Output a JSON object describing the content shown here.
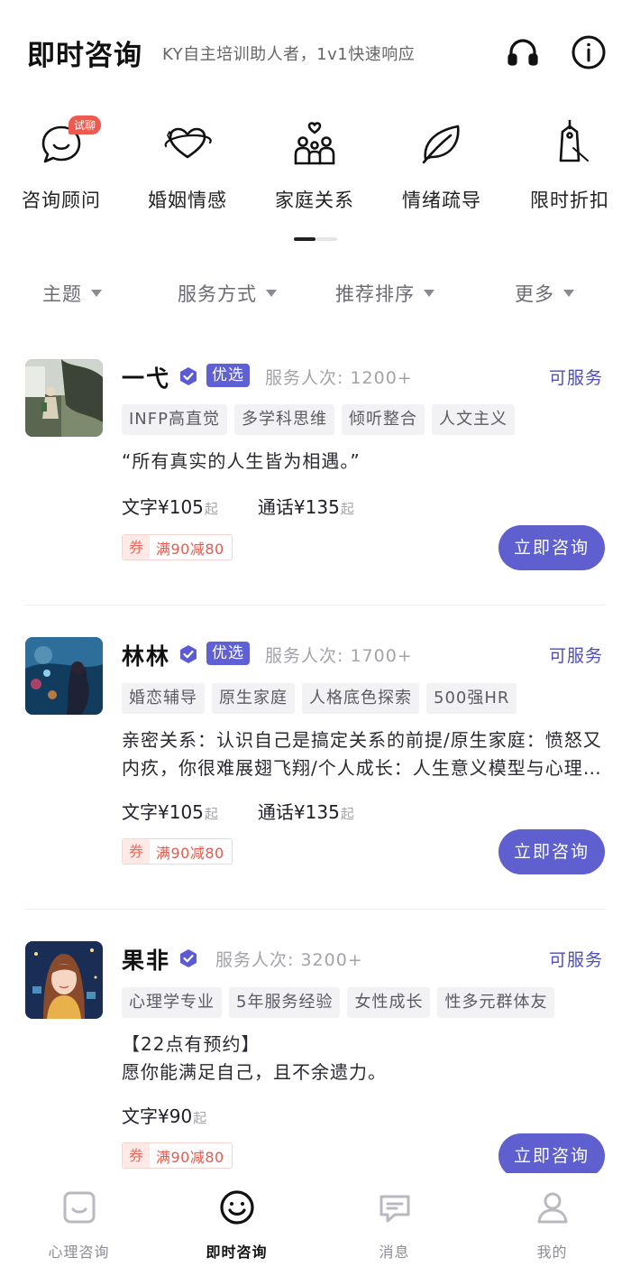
{
  "header": {
    "title": "即时咨询",
    "subtitle": "KY自主培训助人者，1v1快速响应",
    "headset_icon": "headset-icon",
    "info_icon": "info-icon"
  },
  "categories": [
    {
      "label": "咨询顾问",
      "icon": "chat-bubble-icon",
      "badge": "试聊"
    },
    {
      "label": "婚姻情感",
      "icon": "heart-ring-icon"
    },
    {
      "label": "家庭关系",
      "icon": "family-icon"
    },
    {
      "label": "情绪疏导",
      "icon": "leaf-icon"
    },
    {
      "label": "限时折扣",
      "icon": "price-tag-icon"
    }
  ],
  "filters": [
    "主题",
    "服务方式",
    "推荐排序",
    "更多"
  ],
  "counselors": [
    {
      "name": "一弋",
      "verified": true,
      "badge": "优选",
      "served": "服务人次: 1200+",
      "status": "可服务",
      "tags": [
        "INFP高直觉",
        "多学科思维",
        "倾听整合",
        "人文主义"
      ],
      "description": "“所有真实的人生皆为相遇。”",
      "prices": [
        {
          "type": "文字",
          "price": "¥105",
          "suffix": "起"
        },
        {
          "type": "通话",
          "price": "¥135",
          "suffix": "起"
        }
      ],
      "coupon_mark": "券",
      "coupon_text": "满90减80",
      "button": "立即咨询"
    },
    {
      "name": "林林",
      "verified": true,
      "badge": "优选",
      "served": "服务人次: 1700+",
      "status": "可服务",
      "tags": [
        "婚恋辅导",
        "原生家庭",
        "人格底色探索",
        "500强HR"
      ],
      "description": "亲密关系：认识自己是搞定关系的前提/原生家庭：愤怒又内疚，你很难展翅飞翔/个人成长：人生意义模型与心理学的结合",
      "prices": [
        {
          "type": "文字",
          "price": "¥105",
          "suffix": "起"
        },
        {
          "type": "通话",
          "price": "¥135",
          "suffix": "起"
        }
      ],
      "coupon_mark": "券",
      "coupon_text": "满90减80",
      "button": "立即咨询"
    },
    {
      "name": "果非",
      "verified": true,
      "served": "服务人次: 3200+",
      "status": "可服务",
      "tags": [
        "心理学专业",
        "5年服务经验",
        "女性成长",
        "性多元群体友"
      ],
      "description_line1": "【22点有预约】",
      "description_line2": "愿你能满足自己，且不余遗力。",
      "prices": [
        {
          "type": "文字",
          "price": "¥90",
          "suffix": "起"
        }
      ],
      "coupon_mark": "券",
      "coupon_text": "满90减80",
      "button": "立即咨询"
    }
  ],
  "bottom_nav": [
    {
      "label": "心理咨询",
      "icon": "square-smile-icon"
    },
    {
      "label": "即时咨询",
      "icon": "smile-face-icon",
      "active": true
    },
    {
      "label": "消息",
      "icon": "message-icon"
    },
    {
      "label": "我的",
      "icon": "person-icon"
    }
  ],
  "colors": {
    "accent": "#5f5fd0",
    "badge_purple": "#5f5fd6",
    "coupon_red": "#e45a4c",
    "trial_red": "#ee5b4e",
    "status_blue": "#4d4dbd"
  }
}
